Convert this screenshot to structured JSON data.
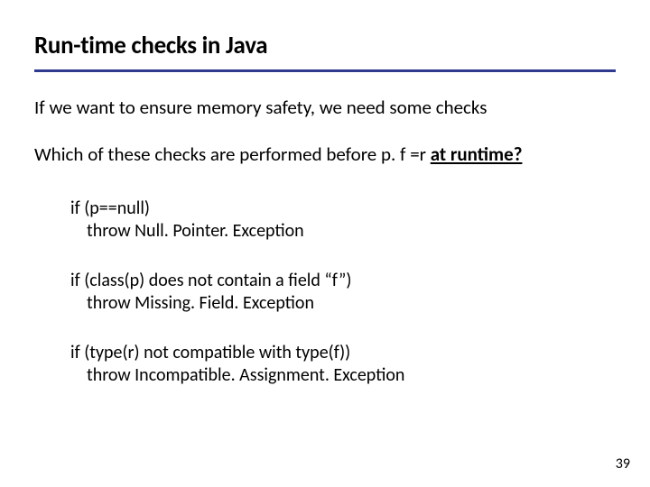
{
  "title": "Run-time checks in Java",
  "intro": "If we want to ensure memory safety, we need some checks",
  "question": {
    "prefix": "Which of these checks are performed before p. f =r ",
    "emph": "at runtime?"
  },
  "checks": [
    {
      "cond": "if (p==null)",
      "throw": "throw Null. Pointer. Exception"
    },
    {
      "cond": "if (class(p) does not contain a field “f”)",
      "throw": "throw Missing. Field. Exception"
    },
    {
      "cond": "if (type(r) not compatible with type(f))",
      "throw": "throw Incompatible. Assignment. Exception"
    }
  ],
  "page_number": "39"
}
